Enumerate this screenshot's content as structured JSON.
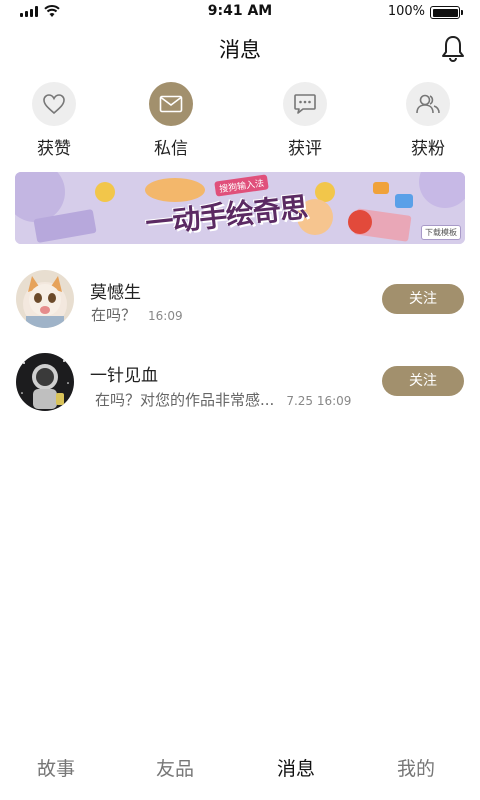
{
  "status_bar": {
    "time": "9:41 AM",
    "battery_text": "100%",
    "battery_level": 1.0,
    "icons": [
      "signal-icon",
      "wifi-icon",
      "battery-icon"
    ]
  },
  "header": {
    "title": "消息",
    "action_icon": "bell-icon"
  },
  "quick_actions": [
    {
      "label": "获赞",
      "icon": "heart-icon",
      "active": false
    },
    {
      "label": "私信",
      "icon": "mail-icon",
      "active": true
    },
    {
      "label": "获评",
      "icon": "comment-icon",
      "active": false
    },
    {
      "label": "获粉",
      "icon": "followers-icon",
      "active": false
    }
  ],
  "banner": {
    "small_text": "搜狗输入法",
    "headline": "一动手绘奇思",
    "tag": "下载模板"
  },
  "messages": [
    {
      "name": "莫憾生",
      "preview": "在吗？",
      "time": "16:09",
      "button": "关注",
      "avatar": "cat-avatar"
    },
    {
      "name": "一针见血",
      "preview": "在吗？对您的作品非常感...",
      "time": "7.25 16:09",
      "button": "关注",
      "avatar": "astronaut-avatar"
    }
  ],
  "tabs": [
    {
      "label": "故事",
      "active": false
    },
    {
      "label": "友品",
      "active": false
    },
    {
      "label": "消息",
      "active": true
    },
    {
      "label": "我的",
      "active": false
    }
  ],
  "colors": {
    "accent": "#a2906d",
    "icon_bg": "#eeeeee",
    "banner_bg": "#d6cdea"
  }
}
